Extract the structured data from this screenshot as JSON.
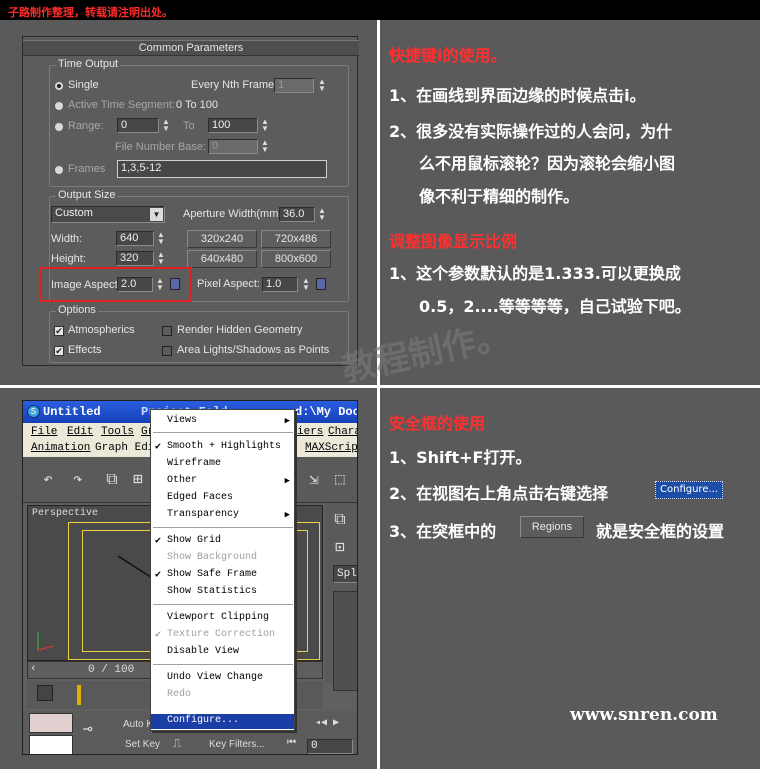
{
  "header": {
    "note": "子路制作整理，转载请注明出处。"
  },
  "panel": {
    "title": "Common Parameters",
    "time_output": {
      "label": "Time Output",
      "single": "Single",
      "every_nth": "Every Nth Frame:",
      "every_nth_value": "1",
      "active_segment": "Active Time Segment:",
      "active_segment_value": "0 To 100",
      "range": "Range:",
      "range_from": "0",
      "to": "To",
      "range_to": "100",
      "file_number_base": "File Number Base:",
      "file_number_base_value": "0",
      "frames": "Frames",
      "frames_value": "1,3,5-12"
    },
    "output_size": {
      "label": "Output Size",
      "preset": "Custom",
      "aperture": "Aperture Width(mm):",
      "aperture_value": "36.0",
      "width": "Width:",
      "width_value": "640",
      "height": "Height:",
      "height_value": "320",
      "presets": [
        "320x240",
        "720x486",
        "640x480",
        "800x600"
      ],
      "image_aspect": "Image Aspect:",
      "image_aspect_value": "2.0",
      "pixel_aspect": "Pixel Aspect:",
      "pixel_aspect_value": "1.0"
    },
    "options": {
      "label": "Options",
      "atmospherics": "Atmospherics",
      "render_hidden": "Render Hidden Geometry",
      "effects": "Effects",
      "area_lights": "Area Lights/Shadows as Points"
    }
  },
  "tips_top": {
    "heading": "快捷键i的使用。",
    "line1": "1、在画线到界面边缘的时候点击i。",
    "line2a": "2、很多没有实际操作过的人会问，为什",
    "line2b": "么不用鼠标滚轮？因为滚轮会缩小图",
    "line2c": "像不利于精细的制作。",
    "heading2": "调整图像显示比例",
    "line3a": "1、这个参数默认的是1.333.可以更换成",
    "line3b": "0.5，2....等等等等，自己试验下吧。"
  },
  "watermark": "教程制作。",
  "maxwin": {
    "title": "Untitled",
    "title_tail": "Project Fold",
    "title_tail2": "d:\\My Doc",
    "menus1": [
      "File",
      "Edit",
      "Tools",
      "Gr"
    ],
    "menus1_right": [
      "iers",
      "Chara"
    ],
    "menus2": [
      "Animation",
      "Graph Edit"
    ],
    "menus2_right": [
      "MAXScript"
    ],
    "viewport_label": "Perspective",
    "time_slider": "0 / 100",
    "auto_key": "Auto K",
    "set_key": "Set Key",
    "key_filters": "Key Filters...",
    "frame_value": "0",
    "right_field": "Splin"
  },
  "context_menu": {
    "items": [
      {
        "label": "Views",
        "check": false,
        "arrow": true,
        "disabled": false
      },
      {
        "label": "Smooth + Highlights",
        "check": true,
        "arrow": false,
        "disabled": false
      },
      {
        "label": "Wireframe",
        "check": false,
        "arrow": false,
        "disabled": false
      },
      {
        "label": "Other",
        "check": false,
        "arrow": true,
        "disabled": false
      },
      {
        "label": "Edged Faces",
        "check": false,
        "arrow": false,
        "disabled": false
      },
      {
        "label": "Transparency",
        "check": false,
        "arrow": true,
        "disabled": false
      },
      {
        "label": "Show Grid",
        "check": true,
        "arrow": false,
        "disabled": false
      },
      {
        "label": "Show Background",
        "check": false,
        "arrow": false,
        "disabled": true
      },
      {
        "label": "Show Safe Frame",
        "check": true,
        "arrow": false,
        "disabled": false
      },
      {
        "label": "Show Statistics",
        "check": false,
        "arrow": false,
        "disabled": false
      },
      {
        "label": "Viewport Clipping",
        "check": false,
        "arrow": false,
        "disabled": false
      },
      {
        "label": "Texture Correction",
        "check": true,
        "arrow": false,
        "disabled": true
      },
      {
        "label": "Disable View",
        "check": false,
        "arrow": false,
        "disabled": false
      },
      {
        "label": "Undo View Change",
        "check": false,
        "arrow": false,
        "disabled": false
      },
      {
        "label": "Redo",
        "check": false,
        "arrow": false,
        "disabled": true
      },
      {
        "label": "Configure...",
        "check": false,
        "arrow": false,
        "disabled": false
      }
    ]
  },
  "tips_bottom": {
    "heading": "安全框的使用",
    "line1": "1、Shift+F打开。",
    "line2": "2、在视图右上角点击右键选择",
    "configure_btn": "Configure...",
    "line3a": "3、在突框中的",
    "regions_btn": "Regions",
    "line3b": "就是安全框的设置"
  },
  "site": "www.snren.com"
}
